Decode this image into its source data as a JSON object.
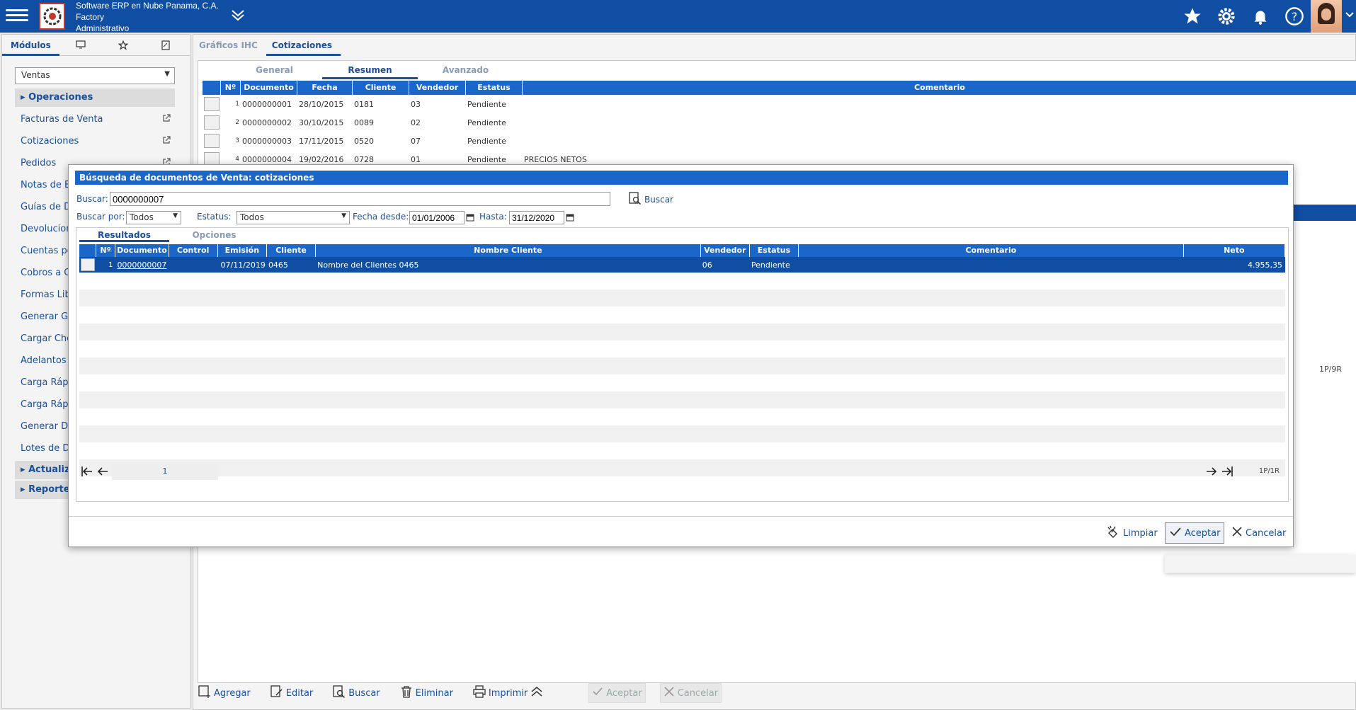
{
  "header": {
    "company": "Software ERP en Nube Panama, C.A.",
    "line2": "Factory",
    "line3": "Administrativo"
  },
  "sidebar": {
    "tab_modules": "Módulos",
    "module_selected": "Ventas",
    "section_operaciones": "Operaciones",
    "items": [
      "Facturas de Venta",
      "Cotizaciones",
      "Pedidos",
      "Notas de E",
      "Guías de D",
      "Devolucion",
      "Cuentas po",
      "Cobros a C",
      "Formas Lib",
      "Generar Gi",
      "Cargar Che",
      "Adelantos",
      "Carga Rápi",
      "Carga Rápi",
      "Generar Do",
      "Lotes de D"
    ],
    "section_actualiz": "Actualiz",
    "section_reporte": "Reporte"
  },
  "main": {
    "tabs": [
      "Gráficos IHC",
      "Cotizaciones"
    ],
    "subtabs": [
      "General",
      "Resumen",
      "Avanzado"
    ],
    "columns": [
      "Nº",
      "Documento",
      "Fecha",
      "Cliente",
      "Vendedor",
      "Estatus",
      "Comentario"
    ],
    "rows": [
      {
        "n": "1",
        "doc": "0000000001",
        "fecha": "28/10/2015",
        "cliente": "0181",
        "vendedor": "03",
        "estatus": "Pendiente",
        "comentario": ""
      },
      {
        "n": "2",
        "doc": "0000000002",
        "fecha": "30/10/2015",
        "cliente": "0089",
        "vendedor": "02",
        "estatus": "Pendiente",
        "comentario": ""
      },
      {
        "n": "3",
        "doc": "0000000003",
        "fecha": "17/11/2015",
        "cliente": "0520",
        "vendedor": "07",
        "estatus": "Pendiente",
        "comentario": ""
      },
      {
        "n": "4",
        "doc": "0000000004",
        "fecha": "19/02/2016",
        "cliente": "0728",
        "vendedor": "01",
        "estatus": "Pendiente",
        "comentario": "PRECIOS NETOS"
      }
    ],
    "pager": "1P/9R"
  },
  "toolbar": {
    "agregar": "Agregar",
    "editar": "Editar",
    "buscar": "Buscar",
    "eliminar": "Eliminar",
    "imprimir": "Imprimir",
    "aceptar": "Aceptar",
    "cancelar": "Cancelar"
  },
  "dialog": {
    "title": "Búsqueda de documentos de Venta: cotizaciones",
    "buscar_label": "Buscar:",
    "buscar_value": "0000000007",
    "buscar_button": "Buscar",
    "buscar_por_label": "Buscar por:",
    "buscar_por_value": "Todos",
    "estatus_label": "Estatus:",
    "estatus_value": "Todos",
    "fecha_desde_label": "Fecha desde:",
    "fecha_desde_value": "01/01/2006",
    "hasta_label": "Hasta:",
    "hasta_value": "31/12/2020",
    "tabs": [
      "Resultados",
      "Opciones"
    ],
    "columns": [
      "Nº",
      "Documento",
      "Control",
      "Emisión",
      "Cliente",
      "Nombre Cliente",
      "Vendedor",
      "Estatus",
      "Comentario",
      "Neto"
    ],
    "row": {
      "n": "1",
      "doc": "0000000007",
      "control": "",
      "emision": "07/11/2019",
      "cliente": "0465",
      "nombre": "Nombre del Clientes 0465",
      "vendedor": "06",
      "estatus": "Pendiente",
      "comentario": "",
      "neto": "4.955,35"
    },
    "page": "1",
    "pager": "1P/1R",
    "limpiar": "Limpiar",
    "aceptar": "Aceptar",
    "cancelar": "Cancelar"
  }
}
